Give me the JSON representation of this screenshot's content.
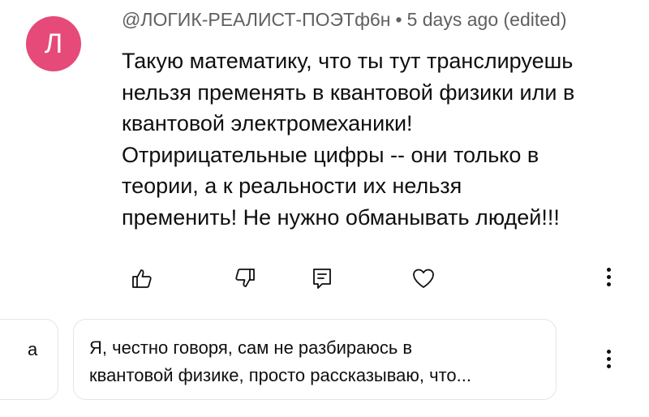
{
  "comment": {
    "avatar_letter": "Л",
    "avatar_color": "#e54a79",
    "author": "@ЛОГИК-РЕАЛИСТ-ПОЭТф6н",
    "separator": "•",
    "timestamp": "5 days ago (edited)",
    "lines": [
      "Такую математику, что ты тут транслируешь",
      "нельзя пременять в квантовой физики или в",
      "квантовой электромеханики!",
      "Отририцательные цифры -- они только в",
      "теории, а к реальности их нельзя",
      "пременить! Не нужно обманывать людей!!!"
    ]
  },
  "actions": {
    "icons": [
      "like-icon",
      "dislike-icon",
      "reply-icon",
      "heart-icon",
      "more-icon"
    ]
  },
  "replies": {
    "previous_fragment": "а",
    "reply_lines": [
      "Я, честно говоря, сам не разбираюсь в",
      "квантовой физике, просто рассказываю, что..."
    ]
  }
}
